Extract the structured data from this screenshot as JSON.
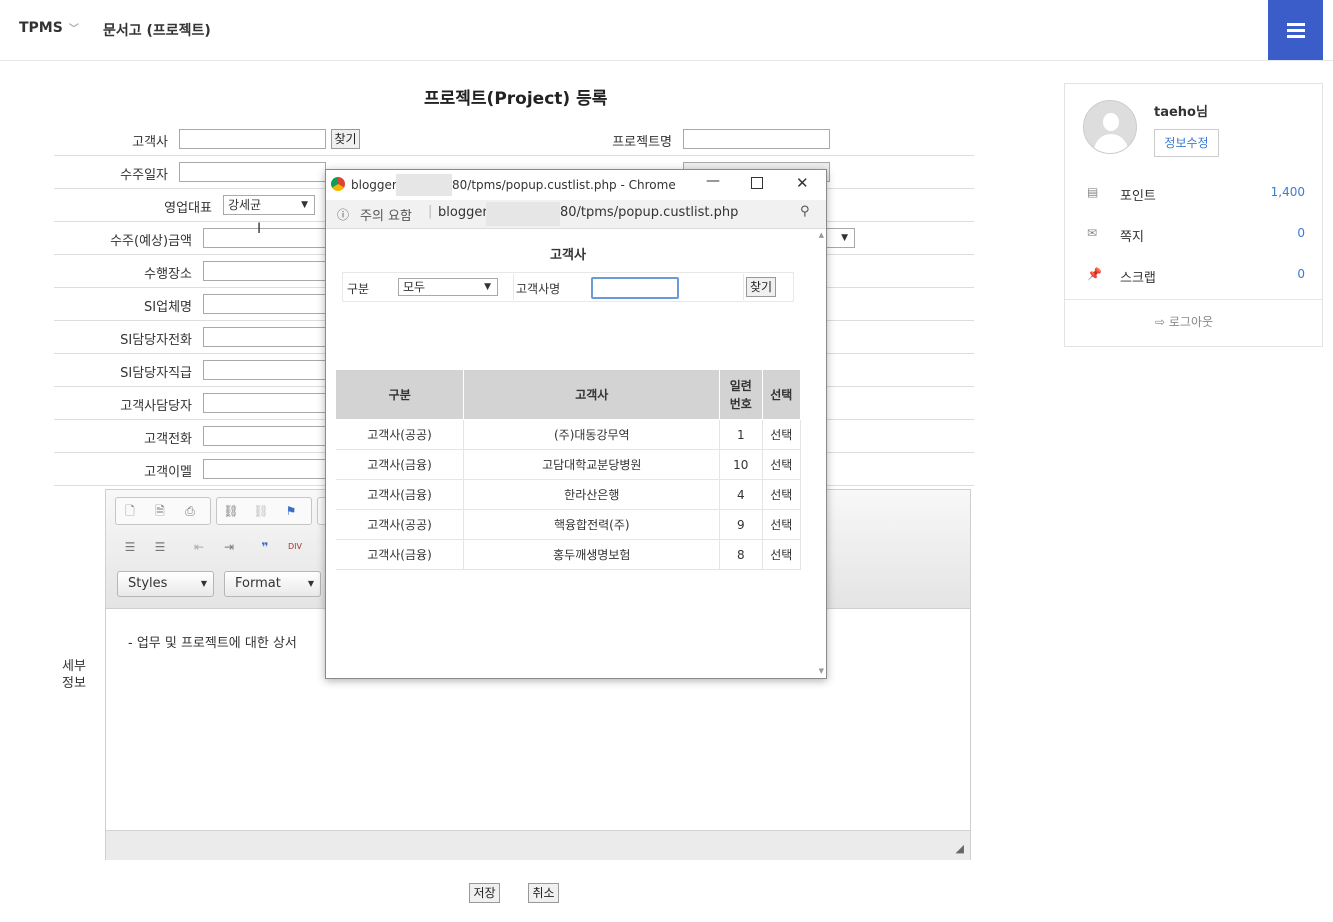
{
  "nav": {
    "brand": "TPMS",
    "crumb": "문서고 (프로젝트)"
  },
  "form": {
    "title": "프로젝트(Project) 등록",
    "labels": {
      "customer": "고객사",
      "project_name": "프로젝트명",
      "order_date": "수주일자",
      "sales_rep": "영업대표",
      "amount": "수주(예상)금액",
      "place": "수행장소",
      "si_company": "SI업체명",
      "si_phone": "SI담당자전화",
      "si_rank": "SI담당자직급",
      "cust_contact": "고객사담당자",
      "cust_phone": "고객전화",
      "cust_email": "고객이멜",
      "detail": "세부\n정보"
    },
    "find_button": "찾기",
    "sales_rep_value": "강세균",
    "save_button": "저장",
    "cancel_button": "취소"
  },
  "editor": {
    "styles_combo": "Styles",
    "format_combo": "Format",
    "body_text": "- 업무 및 프로젝트에 대한 상서"
  },
  "sidebar": {
    "username": "taeho님",
    "edit_profile": "정보수정",
    "items": [
      {
        "label": "포인트",
        "value": "1,400",
        "icon": "database-icon"
      },
      {
        "label": "쪽지",
        "value": "0",
        "icon": "envelope-icon"
      },
      {
        "label": "스크랩",
        "value": "0",
        "icon": "pin-icon"
      }
    ],
    "logout": "로그아웃"
  },
  "popup": {
    "window_title_prefix": "blogger.",
    "window_title_suffix": "80/tpms/popup.custlist.php - Chrome",
    "security_text": "주의 요함",
    "address_prefix": "blogger",
    "address_suffix": "80/tpms/popup.custlist.php",
    "heading": "고객사",
    "filter": {
      "category_label": "구분",
      "category_value": "모두",
      "name_label": "고객사명",
      "name_value": "",
      "find_button": "찾기"
    },
    "table": {
      "headers": [
        "구분",
        "고객사",
        "일련\n번호",
        "선택"
      ],
      "rows": [
        [
          "고객사(공공)",
          "(주)대동강무역",
          "1",
          "선택"
        ],
        [
          "고객사(금융)",
          "고담대학교분당병원",
          "10",
          "선택"
        ],
        [
          "고객사(금융)",
          "한라산은행",
          "4",
          "선택"
        ],
        [
          "고객사(공공)",
          "핵융합전력(주)",
          "9",
          "선택"
        ],
        [
          "고객사(금융)",
          "홍두깨생명보험",
          "8",
          "선택"
        ]
      ]
    }
  }
}
